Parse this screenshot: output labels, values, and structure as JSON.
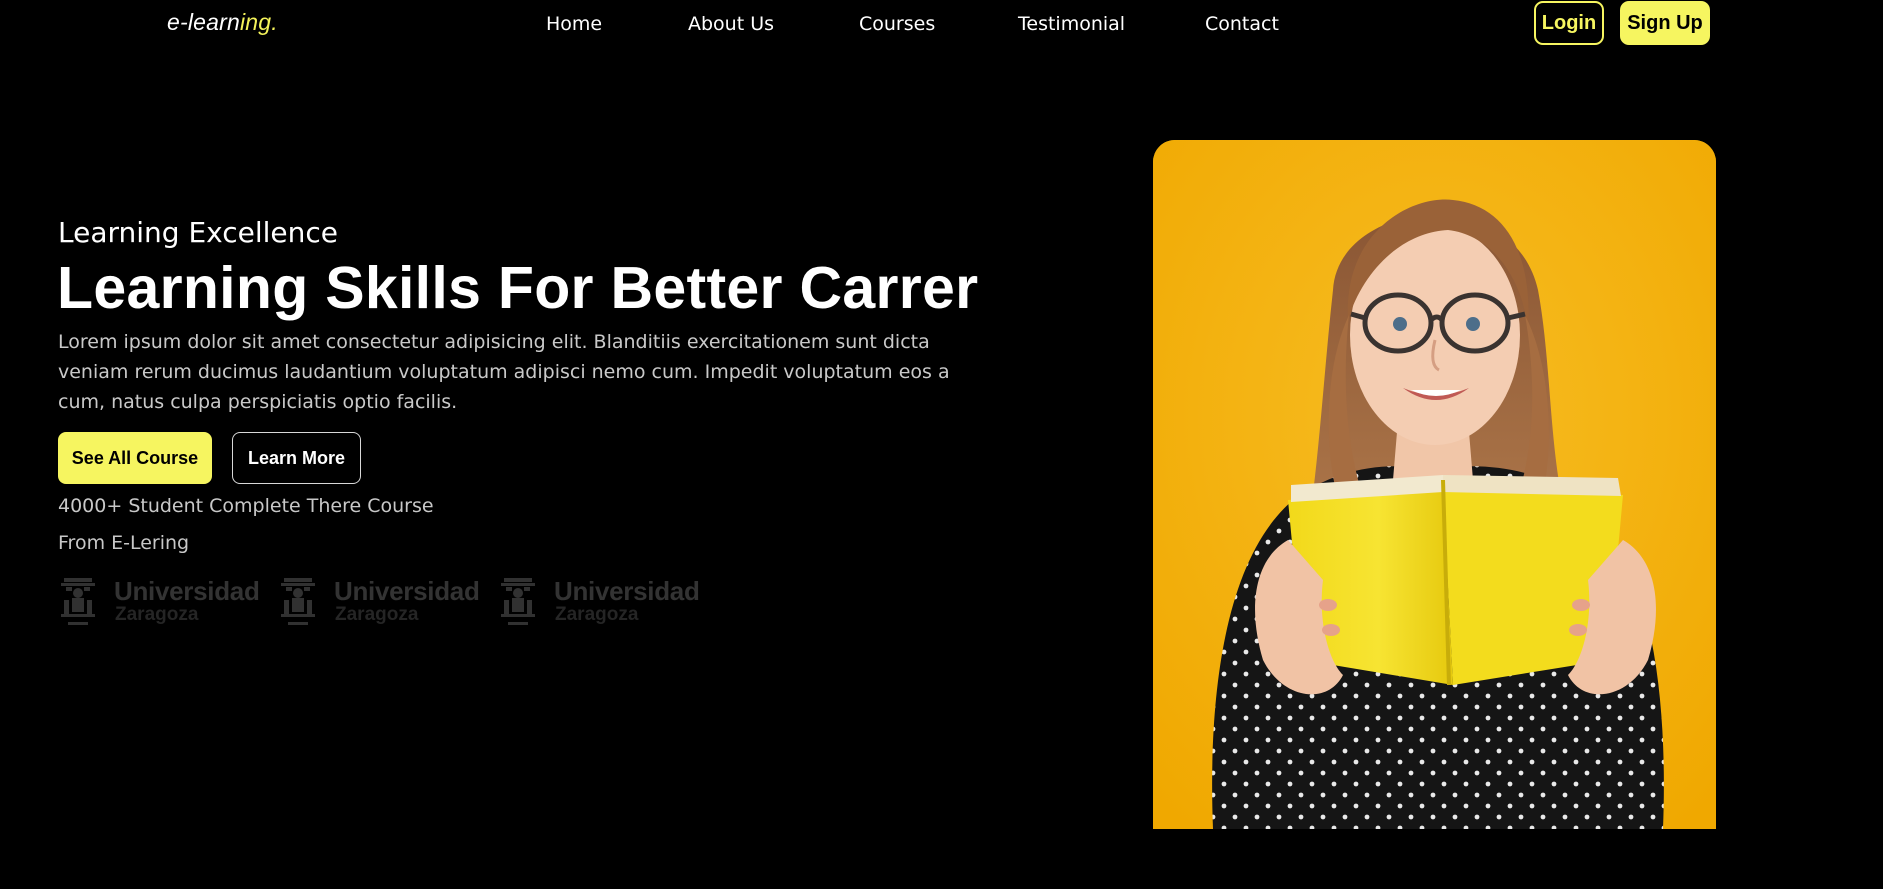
{
  "brand": {
    "logo_prefix": "e-learn",
    "logo_suffix": "ing.",
    "accent_color": "#f6f560"
  },
  "nav": {
    "links": [
      {
        "label": "Home"
      },
      {
        "label": "About Us"
      },
      {
        "label": "Courses"
      },
      {
        "label": "Testimonial"
      },
      {
        "label": "Contact"
      }
    ],
    "login_label": "Login",
    "signup_label": "Sign Up"
  },
  "hero": {
    "eyebrow": "Learning Excellence",
    "headline": "Learning Skills For Better Carrer",
    "lead": "Lorem ipsum dolor sit amet consectetur adipisicing elit. Blanditiis exercitationem sunt dicta veniam rerum ducimus laudantium voluptatum adipisci nemo cum. Impedit voluptatum eos a cum, natus culpa perspiciatis optio facilis.",
    "primary_button": "See All Course",
    "secondary_button": "Learn More",
    "stat_line_1": "4000+ Student Complete There Course",
    "stat_line_2": "From E-Lering",
    "partner_logos": [
      {
        "name": "Universidad",
        "city": "Zaragoza",
        "icon": "university-emblem-icon"
      },
      {
        "name": "Universidad",
        "city": "Zaragoza",
        "icon": "university-emblem-icon"
      },
      {
        "name": "Universidad",
        "city": "Zaragoza",
        "icon": "university-emblem-icon"
      }
    ],
    "image": {
      "subject": "woman-reading-yellow-book",
      "background_color": "#f3b30e"
    }
  }
}
